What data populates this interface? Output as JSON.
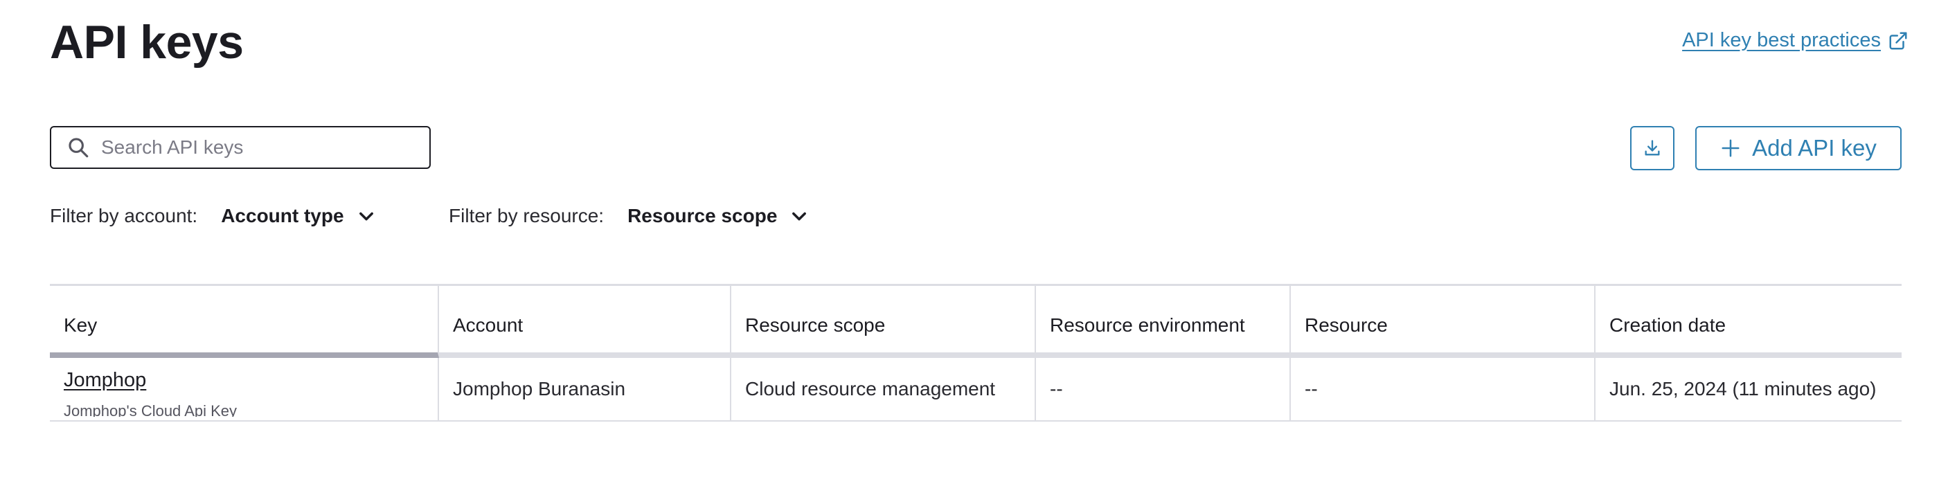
{
  "page": {
    "title": "API keys",
    "best_practices_link": "API key best practices"
  },
  "toolbar": {
    "search_placeholder": "Search API keys",
    "search_value": "",
    "add_label": "Add API key",
    "download_icon": "download-icon",
    "add_icon": "plus-icon"
  },
  "filters": {
    "account_label": "Filter by account:",
    "account_value": "Account type",
    "resource_label": "Filter by resource:",
    "resource_value": "Resource scope"
  },
  "table": {
    "columns": [
      "Key",
      "Account",
      "Resource scope",
      "Resource environment",
      "Resource",
      "Creation date"
    ],
    "rows": [
      {
        "key": "Jomphop",
        "key_description": "Jomphop's Cloud Api Key",
        "account": "Jomphop Buranasin",
        "resource_scope": "Cloud resource management",
        "resource_environment": "--",
        "resource": "--",
        "creation_date": "Jun. 25, 2024 (11 minutes ago)"
      }
    ]
  },
  "colors": {
    "accent": "#2f80b2",
    "text": "#1c1c22",
    "border": "#dcdde3",
    "sorted_indicator": "#a5a6b2"
  }
}
